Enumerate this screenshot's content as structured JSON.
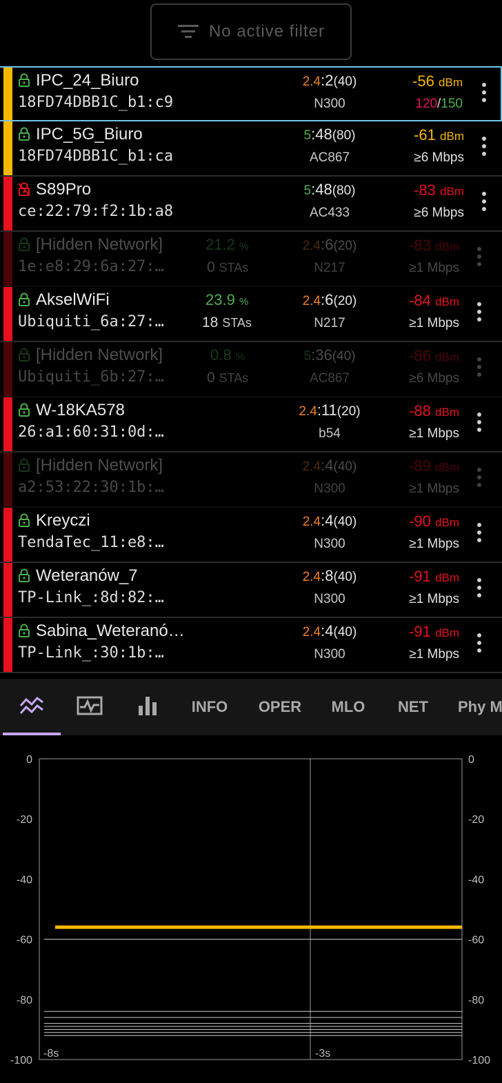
{
  "filter": {
    "label": "No active filter",
    "icon": "filter-list-icon"
  },
  "networks": [
    {
      "ssid": "IPC_24_Biuro",
      "bssid": "18FD74DBB1C_b1:c9",
      "band": "2.4",
      "channel": "2",
      "width": "(40)",
      "standard": "N300",
      "dbm": "-56",
      "dbm_unit": "dBm",
      "rate_a": "120",
      "rate_sep": "/",
      "rate_b": "150",
      "rate": "",
      "pct": "",
      "stas": "",
      "bar_color": "#f5b800",
      "dbm_color": "#f5b800",
      "band_color": "#f07f1f",
      "lock_color": "#4caf50",
      "locked": true,
      "dim": false,
      "selected": true
    },
    {
      "ssid": "IPC_5G_Biuro",
      "bssid": "18FD74DBB1C_b1:ca",
      "band": "5",
      "channel": "48",
      "width": "(80)",
      "standard": "AC867",
      "dbm": "-61",
      "dbm_unit": "dBm",
      "rate": "≥6 Mbps",
      "pct": "",
      "stas": "",
      "bar_color": "#f5b800",
      "dbm_color": "#f5b800",
      "band_color": "#4caf50",
      "lock_color": "#4caf50",
      "locked": true,
      "dim": false,
      "selected": false
    },
    {
      "ssid": "S89Pro",
      "bssid": "ce:22:79:f2:1b:a8",
      "band": "5",
      "channel": "48",
      "width": "(80)",
      "standard": "AC433",
      "dbm": "-83",
      "dbm_unit": "dBm",
      "rate": "≥6 Mbps",
      "pct": "",
      "stas": "",
      "bar_color": "#e5111f",
      "dbm_color": "#e5111f",
      "band_color": "#4caf50",
      "lock_color": "#e5111f",
      "locked": true,
      "dim": false,
      "selected": false
    },
    {
      "ssid": "[Hidden Network]",
      "bssid": "1e:e8:29:6a:27:…",
      "band": "2.4",
      "channel": "6",
      "width": "(20)",
      "standard": "N217",
      "dbm": "-83",
      "dbm_unit": "dBm",
      "rate": "≥1 Mbps",
      "pct": "21.2",
      "pct_unit": "%",
      "stas": "0",
      "stas_unit": "STAs",
      "bar_color": "#e5111f",
      "dbm_color": "#e5111f",
      "band_color": "#f07f1f",
      "lock_color": "#4caf50",
      "locked": true,
      "dim": true,
      "selected": false
    },
    {
      "ssid": "AkselWiFi",
      "bssid": "Ubiquiti_6a:27:…",
      "band": "2.4",
      "channel": "6",
      "width": "(20)",
      "standard": "N217",
      "dbm": "-84",
      "dbm_unit": "dBm",
      "rate": "≥1 Mbps",
      "pct": "23.9",
      "pct_unit": "%",
      "stas": "18",
      "stas_unit": "STAs",
      "bar_color": "#e5111f",
      "dbm_color": "#e5111f",
      "band_color": "#f07f1f",
      "lock_color": "#4caf50",
      "locked": true,
      "dim": false,
      "selected": false
    },
    {
      "ssid": "[Hidden Network]",
      "bssid": "Ubiquiti_6b:27:…",
      "band": "5",
      "channel": "36",
      "width": "(40)",
      "standard": "AC867",
      "dbm": "-86",
      "dbm_unit": "dBm",
      "rate": "≥6 Mbps",
      "pct": "0.8",
      "pct_unit": "%",
      "stas": "0",
      "stas_unit": "STAs",
      "bar_color": "#e5111f",
      "dbm_color": "#e5111f",
      "band_color": "#4caf50",
      "lock_color": "#4caf50",
      "locked": true,
      "dim": true,
      "selected": false
    },
    {
      "ssid": "W-18KA578",
      "bssid": "26:a1:60:31:0d:…",
      "band": "2.4",
      "channel": "11",
      "width": "(20)",
      "standard": "b54",
      "dbm": "-88",
      "dbm_unit": "dBm",
      "rate": "≥1 Mbps",
      "pct": "",
      "stas": "",
      "bar_color": "#e5111f",
      "dbm_color": "#e5111f",
      "band_color": "#f07f1f",
      "lock_color": "#4caf50",
      "locked": true,
      "dim": false,
      "selected": false
    },
    {
      "ssid": "[Hidden Network]",
      "bssid": "a2:53:22:30:1b:…",
      "band": "2.4",
      "channel": "4",
      "width": "(40)",
      "standard": "N300",
      "dbm": "-89",
      "dbm_unit": "dBm",
      "rate": "≥1 Mbps",
      "pct": "",
      "stas": "",
      "bar_color": "#e5111f",
      "dbm_color": "#e5111f",
      "band_color": "#f07f1f",
      "lock_color": "#4caf50",
      "locked": true,
      "dim": true,
      "selected": false
    },
    {
      "ssid": "Kreyczi",
      "bssid": "TendaTec_11:e8:…",
      "band": "2.4",
      "channel": "4",
      "width": "(40)",
      "standard": "N300",
      "dbm": "-90",
      "dbm_unit": "dBm",
      "rate": "≥1 Mbps",
      "pct": "",
      "stas": "",
      "bar_color": "#e5111f",
      "dbm_color": "#e5111f",
      "band_color": "#f07f1f",
      "lock_color": "#4caf50",
      "locked": true,
      "dim": false,
      "selected": false
    },
    {
      "ssid": "Weteranów_7",
      "bssid": "TP-Link_:8d:82:…",
      "band": "2.4",
      "channel": "8",
      "width": "(40)",
      "standard": "N300",
      "dbm": "-91",
      "dbm_unit": "dBm",
      "rate": "≥1 Mbps",
      "pct": "",
      "stas": "",
      "bar_color": "#e5111f",
      "dbm_color": "#e5111f",
      "band_color": "#f07f1f",
      "lock_color": "#4caf50",
      "locked": true,
      "dim": false,
      "selected": false
    },
    {
      "ssid": "Sabina_Weteranó…",
      "bssid": "TP-Link_:30:1b:…",
      "band": "2.4",
      "channel": "4",
      "width": "(40)",
      "standard": "N300",
      "dbm": "-91",
      "dbm_unit": "dBm",
      "rate": "≥1 Mbps",
      "pct": "",
      "stas": "",
      "bar_color": "#e5111f",
      "dbm_color": "#e5111f",
      "band_color": "#f07f1f",
      "lock_color": "#4caf50",
      "locked": true,
      "dim": false,
      "selected": false
    }
  ],
  "tabs": [
    {
      "icon": "signal-time-graph-icon",
      "label": ""
    },
    {
      "icon": "signal-monitor-icon",
      "label": ""
    },
    {
      "icon": "bar-chart-icon",
      "label": ""
    },
    {
      "icon": "",
      "label": "INFO"
    },
    {
      "icon": "",
      "label": "OPER"
    },
    {
      "icon": "",
      "label": "MLO"
    },
    {
      "icon": "",
      "label": "NET"
    },
    {
      "icon": "",
      "label": "Phy M"
    }
  ],
  "tab_active_index": 0,
  "colors": {
    "accent": "#c7a6f5",
    "selected_outline": "#6fc7e8",
    "series_primary": "#f5b800",
    "grid": "#9a9a9a"
  },
  "chart_data": {
    "type": "line",
    "ylim": [
      -100,
      0
    ],
    "yticks": [
      0,
      -20,
      -40,
      -60,
      -80,
      -100
    ],
    "xtick_labels": [
      "-8s",
      "-3s"
    ],
    "grid": true,
    "series": [
      {
        "values": [
          -56,
          -56
        ],
        "color": "#f5b800"
      },
      {
        "values": [
          -60,
          -60
        ],
        "color": "#cfcfcf"
      },
      {
        "values": [
          -84,
          -84
        ],
        "color": "#cfcfcf"
      },
      {
        "values": [
          -86,
          -86
        ],
        "color": "#cfcfcf"
      },
      {
        "values": [
          -88,
          -88
        ],
        "color": "#cfcfcf"
      },
      {
        "values": [
          -89,
          -89
        ],
        "color": "#cfcfcf"
      },
      {
        "values": [
          -90,
          -90
        ],
        "color": "#cfcfcf"
      },
      {
        "values": [
          -91,
          -91
        ],
        "color": "#cfcfcf"
      },
      {
        "values": [
          -92,
          -92
        ],
        "color": "#cfcfcf"
      }
    ]
  }
}
